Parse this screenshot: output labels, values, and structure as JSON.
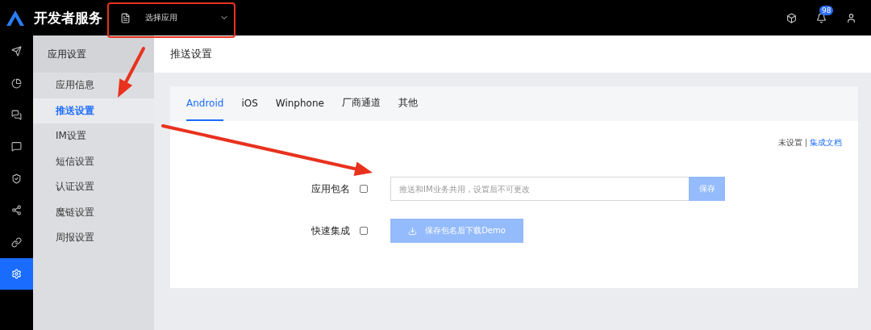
{
  "top_bar": {
    "brand": "开发者服务",
    "app_select": {
      "placeholder": "选择应用"
    },
    "notification_count": "98"
  },
  "rail": [
    {
      "selected": false
    },
    {
      "selected": false
    },
    {
      "selected": false
    },
    {
      "selected": false
    },
    {
      "selected": false
    },
    {
      "selected": false
    },
    {
      "selected": false
    },
    {
      "selected": true
    }
  ],
  "sidebar": {
    "title": "应用设置",
    "items": [
      {
        "label": "应用信息",
        "selected": false
      },
      {
        "label": "推送设置",
        "selected": true
      },
      {
        "label": "IM设置",
        "selected": false
      },
      {
        "label": "短信设置",
        "selected": false
      },
      {
        "label": "认证设置",
        "selected": false
      },
      {
        "label": "魔链设置",
        "selected": false
      },
      {
        "label": "周报设置",
        "selected": false
      }
    ]
  },
  "page_title": "推送设置",
  "tabs": [
    {
      "label": "Android",
      "selected": true
    },
    {
      "label": "iOS",
      "selected": false
    },
    {
      "label": "Winphone",
      "selected": false
    },
    {
      "label": "厂商通道",
      "selected": false
    },
    {
      "label": "其他",
      "selected": false
    }
  ],
  "status": {
    "text": "未设置",
    "link": "集成文档"
  },
  "form": {
    "package": {
      "label": "应用包名",
      "placeholder": "推送和IM业务共用，设置后不可更改",
      "button": "保存",
      "disabled": true
    },
    "quick": {
      "label": "快速集成",
      "button": "保存包名后下载Demo",
      "disabled": true
    }
  },
  "annotations": [
    {
      "kind": "frame"
    },
    {
      "kind": "arrow"
    },
    {
      "kind": "arrow"
    }
  ]
}
